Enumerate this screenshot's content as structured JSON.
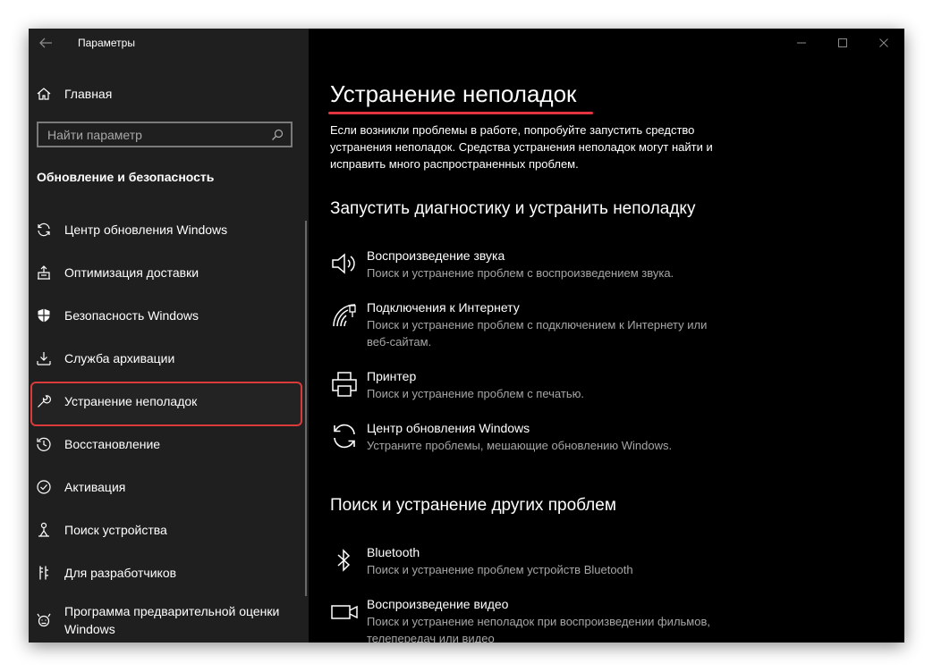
{
  "window": {
    "app_title": "Параметры"
  },
  "sidebar": {
    "home_label": "Главная",
    "search_placeholder": "Найти параметр",
    "section_title": "Обновление и безопасность",
    "items": [
      {
        "label": "Центр обновления Windows",
        "icon": "sync-icon"
      },
      {
        "label": "Оптимизация доставки",
        "icon": "delivery-icon"
      },
      {
        "label": "Безопасность Windows",
        "icon": "shield-icon"
      },
      {
        "label": "Служба архивации",
        "icon": "backup-icon"
      },
      {
        "label": "Устранение неполадок",
        "icon": "wrench-icon",
        "selected": true
      },
      {
        "label": "Восстановление",
        "icon": "recovery-icon"
      },
      {
        "label": "Активация",
        "icon": "activation-check-icon"
      },
      {
        "label": "Поиск устройства",
        "icon": "find-device-icon"
      },
      {
        "label": "Для разработчиков",
        "icon": "developer-icon"
      },
      {
        "label": "Программа предварительной оценки Windows",
        "icon": "insider-icon"
      }
    ]
  },
  "main": {
    "title": "Устранение неполадок",
    "description": "Если возникли проблемы в работе, попробуйте запустить средство устранения неполадок. Средства устранения неполадок могут найти и исправить много распространенных проблем.",
    "section1_title": "Запустить диагностику и устранить неполадку",
    "section1_items": [
      {
        "name": "Воспроизведение звука",
        "desc": "Поиск и устранение проблем с воспроизведением звука.",
        "icon": "speaker-icon"
      },
      {
        "name": "Подключения к Интернету",
        "desc": "Поиск и устранение проблем с подключением к Интернету или веб-сайтам.",
        "icon": "wifi-icon"
      },
      {
        "name": "Принтер",
        "desc": "Поиск и устранение проблем с печатью.",
        "icon": "printer-icon"
      },
      {
        "name": "Центр обновления Windows",
        "desc": "Устраните проблемы, мешающие обновлению Windows.",
        "icon": "sync-icon"
      }
    ],
    "section2_title": "Поиск и устранение других проблем",
    "section2_items": [
      {
        "name": "Bluetooth",
        "desc": "Поиск и устранение проблем устройств Bluetooth",
        "icon": "bluetooth-icon"
      },
      {
        "name": "Воспроизведение видео",
        "desc": "Поиск и устранение неполадок при воспроизведении фильмов, телепередач или видео",
        "icon": "video-icon"
      }
    ]
  },
  "colors": {
    "sidebar_bg": "#1f1f1f",
    "main_bg": "#000000",
    "highlight_red": "#e2353f",
    "secondary_text": "#a6a6a6"
  }
}
